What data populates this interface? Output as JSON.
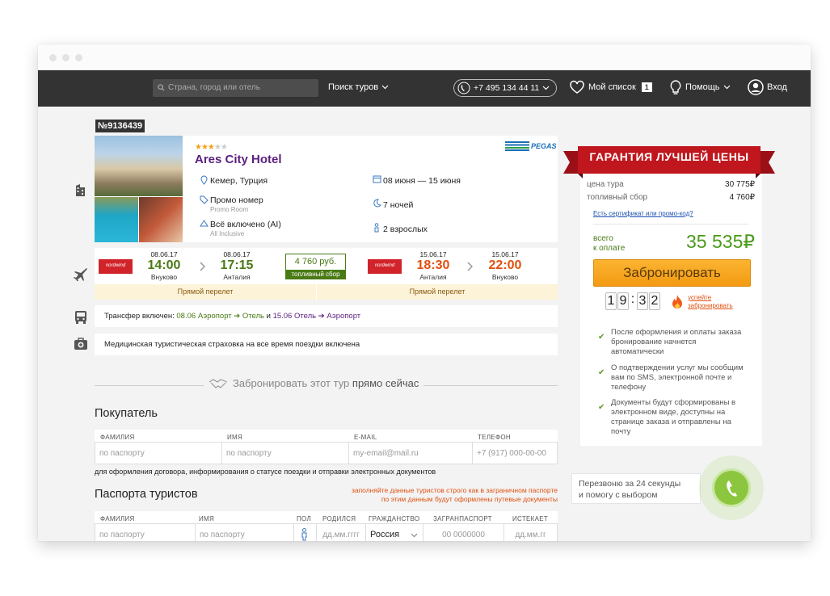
{
  "nav": {
    "search_placeholder": "Страна, город или отель",
    "tours": "Поиск туров",
    "phone": "+7 495 134 44 11",
    "wishlist": "Мой список",
    "wishlist_count": "1",
    "help": "Помощь",
    "login": "Вход"
  },
  "hotel": {
    "id": "№9136439",
    "stars": 3,
    "name": "Ares City Hotel",
    "location": "Кемер, Турция",
    "room": "Промо номер",
    "room_sub": "Promo Room",
    "meal": "Всё включено (AI)",
    "meal_sub": "All Inclusive",
    "dates": "08 июня — 15 июня",
    "nights": "7 ночей",
    "guests": "2 взрослых",
    "operator": "PEGAS"
  },
  "flights": {
    "out": {
      "date1": "08.06.17",
      "time1": "14:00",
      "place1": "Внуково",
      "date2": "08.06.17",
      "time2": "17:15",
      "place2": "Анталия",
      "type": "Прямой перелет"
    },
    "back": {
      "date1": "15.06.17",
      "time1": "18:30",
      "place1": "Анталия",
      "date2": "15.06.17",
      "time2": "22:00",
      "place2": "Внуково",
      "type": "Прямой перелет"
    },
    "fuel_amount": "4 760 руб.",
    "fuel_label": "топливный сбор",
    "airline": "nordwind"
  },
  "transfer": {
    "prefix": "Трансфер включен: ",
    "d1": "08.06",
    "seg1": "Аэропорт ➔ Отель",
    "and": " и ",
    "d2": "15.06",
    "seg2": "Отель ➔ Аэропорт"
  },
  "insurance": "Медицинская туристическая страховка на все время поездки включена",
  "book_now": {
    "light": "Забронировать этот тур ",
    "bold": "прямо сейчас"
  },
  "buyer": {
    "title": "Покупатель",
    "cols": [
      "ФАМИЛИЯ",
      "ИМЯ",
      "E-MAIL",
      "ТЕЛЕФОН"
    ],
    "placeholders": [
      "по паспорту",
      "по паспорту",
      "my-email@mail.ru",
      "+7 (917) 000-00-00"
    ],
    "note": "для оформления договора, информирования о статусе поездки и отправки электронных документов"
  },
  "passports": {
    "title": "Паспорта туристов",
    "warning1": "заполняйте данные туристов строго как в заграничном паспорте",
    "warning2": "по этим данным будут оформлены путевые документы",
    "cols": [
      "ФАМИЛИЯ",
      "ИМЯ",
      "ПОЛ",
      "РОДИЛСЯ",
      "ГРАЖДАНСТВО",
      "ЗАГРАНПАСПОРТ",
      "ИСТЕКАЕТ"
    ],
    "placeholders": [
      "по паспорту",
      "по паспорту",
      "",
      "дд.мм.гггг",
      "Россия",
      "00 0000000",
      "дд.мм.гг"
    ]
  },
  "price": {
    "banner": "ГАРАНТИЯ ЛУЧШЕЙ ЦЕНЫ",
    "tour_label": "цена тура",
    "tour_value": "30 775₽",
    "fuel_label": "топливный сбор",
    "fuel_value": "4 760₽",
    "promo": "Есть сертификат или промо-код?",
    "total_label1": "всего",
    "total_label2": "к оплате",
    "total": "35 535₽",
    "book": "Забронировать",
    "timer": [
      "1",
      "9",
      ":",
      "3",
      "2"
    ],
    "hurry1": "успейте",
    "hurry2": "забронировать"
  },
  "guarantees": [
    "После оформления и оплаты заказа бронирование начнется автоматически",
    "О подтверждении услуг мы сообщим вам по SMS, электронной почте и телефону",
    "Документы будут сформированы в электронном виде, доступны на странице заказа и отправлены на почту"
  ],
  "callback": {
    "line1": "Перезвоню за 24 секунды",
    "line2": "и помогу с выбором"
  },
  "colors": {
    "purple": "#5b1f7e",
    "green": "#4a7a14",
    "orange": "#e0500f",
    "red": "#c0161d",
    "button": "#f7a51c"
  }
}
